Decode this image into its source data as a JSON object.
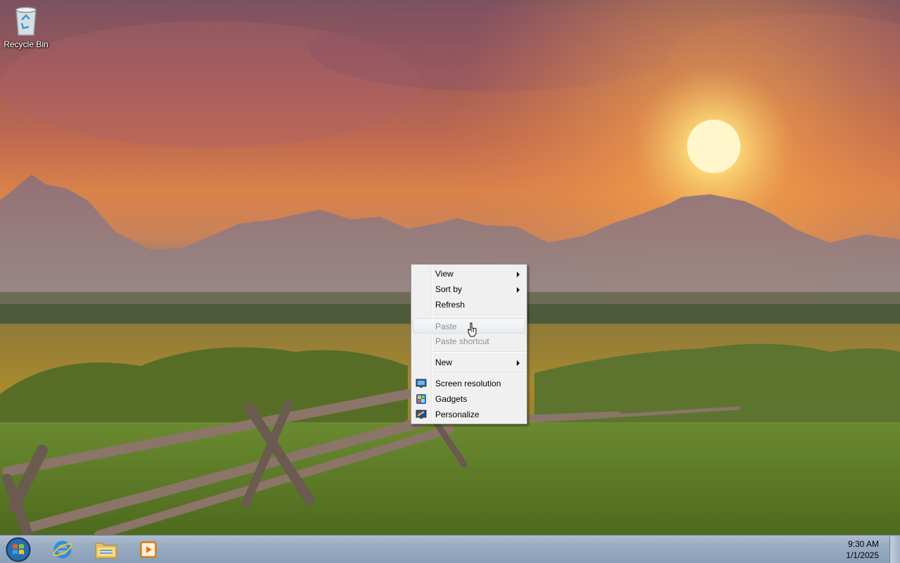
{
  "desktop": {
    "icons": [
      {
        "label": "Recycle Bin",
        "icon": "recycle-bin-icon"
      }
    ]
  },
  "context_menu": {
    "items": [
      {
        "label": "View",
        "submenu": true,
        "enabled": true
      },
      {
        "label": "Sort by",
        "submenu": true,
        "enabled": true
      },
      {
        "label": "Refresh",
        "submenu": false,
        "enabled": true
      },
      {
        "label": "Paste",
        "submenu": false,
        "enabled": false,
        "hovered": true
      },
      {
        "label": "Paste shortcut",
        "submenu": false,
        "enabled": false
      },
      {
        "label": "New",
        "submenu": true,
        "enabled": true
      },
      {
        "label": "Screen resolution",
        "submenu": false,
        "enabled": true,
        "icon": "screen-resolution-icon"
      },
      {
        "label": "Gadgets",
        "submenu": false,
        "enabled": true,
        "icon": "gadgets-icon"
      },
      {
        "label": "Personalize",
        "submenu": false,
        "enabled": true,
        "icon": "personalize-icon"
      }
    ]
  },
  "taskbar": {
    "start_icon": "windows-start-orb-icon",
    "pinned": [
      {
        "name": "Internet Explorer",
        "icon": "internet-explorer-icon"
      },
      {
        "name": "Windows Explorer",
        "icon": "folder-explorer-icon"
      },
      {
        "name": "Windows Media Player",
        "icon": "media-player-icon"
      }
    ],
    "clock": {
      "time": "9:30 AM",
      "date": "1/1/2025"
    }
  },
  "colors": {
    "menu_background": "#f0f0f0",
    "taskbar": "#98abc1",
    "sun": "#fff6cc"
  }
}
